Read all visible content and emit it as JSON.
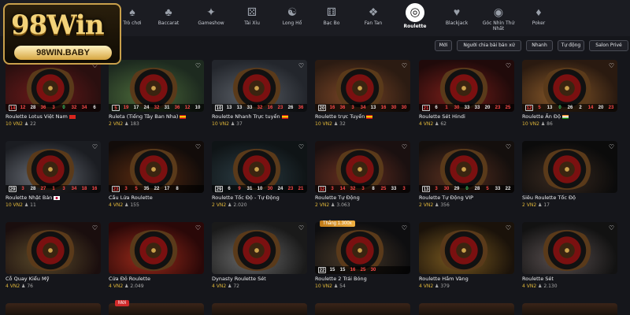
{
  "logo": {
    "big": "98Win",
    "sub": "98WIN.BABY"
  },
  "nav": [
    {
      "label": "Trò chơi",
      "icon": "game-icon"
    },
    {
      "label": "Baccarat",
      "icon": "baccarat-icon"
    },
    {
      "label": "Gameshow",
      "icon": "gameshow-icon"
    },
    {
      "label": "Tài Xỉu",
      "icon": "dice-icon"
    },
    {
      "label": "Long Hổ",
      "icon": "dragon-tiger-icon"
    },
    {
      "label": "Bạc Bo",
      "icon": "sicbo-icon"
    },
    {
      "label": "Fan Tan",
      "icon": "fantan-icon"
    },
    {
      "label": "Roulette",
      "icon": "roulette-icon"
    },
    {
      "label": "Blackjack",
      "icon": "blackjack-icon"
    },
    {
      "label": "Góc Nhìn Thứ Nhất",
      "icon": "first-person-icon"
    },
    {
      "label": "Poker",
      "icon": "poker-icon"
    }
  ],
  "filters": [
    "Mới",
    "Người chia bài bản xứ",
    "Nhanh",
    "Tự động",
    "Salon Privé"
  ],
  "cards": [
    {
      "title": "Roulette Lotus Việt Nam",
      "bet": "10 VN2",
      "players": "22",
      "flag": "vn",
      "nums": [
        {
          "v": "14",
          "c": "red",
          "box": true
        },
        {
          "v": "12",
          "c": "red"
        },
        {
          "v": "28",
          "c": "blk"
        },
        {
          "v": "36",
          "c": "red"
        },
        {
          "v": "3",
          "c": "red"
        },
        {
          "v": "0",
          "c": "grn"
        },
        {
          "v": "32",
          "c": "red"
        },
        {
          "v": "34",
          "c": "red"
        },
        {
          "v": "6",
          "c": "blk"
        }
      ]
    },
    {
      "title": "Ruleta (Tiếng Tây Ban Nha)",
      "bet": "2 VN2",
      "players": "183",
      "flag": "es",
      "nums": [
        {
          "v": "5",
          "c": "red",
          "box": true
        },
        {
          "v": "19",
          "c": "red"
        },
        {
          "v": "17",
          "c": "blk"
        },
        {
          "v": "24",
          "c": "blk"
        },
        {
          "v": "32",
          "c": "red"
        },
        {
          "v": "31",
          "c": "blk"
        },
        {
          "v": "36",
          "c": "red"
        },
        {
          "v": "12",
          "c": "red"
        },
        {
          "v": "10",
          "c": "blk"
        }
      ]
    },
    {
      "title": "Roulette Nhanh Trực tuyến",
      "bet": "10 VN2",
      "players": "37",
      "flag": "es",
      "nums": [
        {
          "v": "10",
          "c": "blk",
          "box": true
        },
        {
          "v": "13",
          "c": "blk"
        },
        {
          "v": "13",
          "c": "blk"
        },
        {
          "v": "33",
          "c": "blk"
        },
        {
          "v": "32",
          "c": "red"
        },
        {
          "v": "16",
          "c": "red"
        },
        {
          "v": "23",
          "c": "red"
        },
        {
          "v": "26",
          "c": "blk"
        },
        {
          "v": "36",
          "c": "red"
        }
      ]
    },
    {
      "title": "Roulette trực Tuyến",
      "bet": "10 VN2",
      "players": "32",
      "flag": "es",
      "nums": [
        {
          "v": "20",
          "c": "blk",
          "box": true
        },
        {
          "v": "16",
          "c": "red"
        },
        {
          "v": "36",
          "c": "red"
        },
        {
          "v": "3",
          "c": "red"
        },
        {
          "v": "34",
          "c": "red"
        },
        {
          "v": "13",
          "c": "blk"
        },
        {
          "v": "16",
          "c": "red"
        },
        {
          "v": "30",
          "c": "red"
        },
        {
          "v": "30",
          "c": "red"
        }
      ]
    },
    {
      "title": "Roulette Sét Hindi",
      "bet": "4 VN2",
      "players": "62",
      "flag": "",
      "nums": [
        {
          "v": "21",
          "c": "red",
          "box": true
        },
        {
          "v": "6",
          "c": "blk"
        },
        {
          "v": "1",
          "c": "red"
        },
        {
          "v": "30",
          "c": "red"
        },
        {
          "v": "33",
          "c": "blk"
        },
        {
          "v": "33",
          "c": "blk"
        },
        {
          "v": "20",
          "c": "blk"
        },
        {
          "v": "23",
          "c": "red"
        },
        {
          "v": "25",
          "c": "red"
        }
      ]
    },
    {
      "title": "Roulette Ấn Độ",
      "bet": "10 VN2",
      "players": "86",
      "flag": "in",
      "nums": [
        {
          "v": "12",
          "c": "red",
          "box": true
        },
        {
          "v": "5",
          "c": "red"
        },
        {
          "v": "13",
          "c": "blk"
        },
        {
          "v": "0",
          "c": "grn"
        },
        {
          "v": "26",
          "c": "blk"
        },
        {
          "v": "2",
          "c": "blk"
        },
        {
          "v": "14",
          "c": "red"
        },
        {
          "v": "20",
          "c": "blk"
        },
        {
          "v": "23",
          "c": "red"
        }
      ]
    },
    {
      "title": "Roulette Nhật Bản",
      "bet": "10 VN2",
      "players": "11",
      "flag": "jp",
      "nums": [
        {
          "v": "29",
          "c": "blk",
          "box": true
        },
        {
          "v": "3",
          "c": "red"
        },
        {
          "v": "28",
          "c": "blk"
        },
        {
          "v": "27",
          "c": "red"
        },
        {
          "v": "1",
          "c": "red"
        },
        {
          "v": "3",
          "c": "red"
        },
        {
          "v": "34",
          "c": "red"
        },
        {
          "v": "18",
          "c": "red"
        },
        {
          "v": "16",
          "c": "red"
        }
      ]
    },
    {
      "title": "Cầu Lửa Roulette",
      "bet": "4 VN2",
      "players": "155",
      "flag": "",
      "nums": [
        {
          "v": "23",
          "c": "red",
          "box": true
        },
        {
          "v": "3",
          "c": "red"
        },
        {
          "v": "5",
          "c": "red"
        },
        {
          "v": "35",
          "c": "blk"
        },
        {
          "v": "22",
          "c": "blk"
        },
        {
          "v": "17",
          "c": "blk"
        },
        {
          "v": "8",
          "c": "blk"
        },
        {
          "v": "",
          "c": "blk"
        },
        {
          "v": "",
          "c": "blk"
        }
      ]
    },
    {
      "title": "Roulette Tốc Độ - Tự Động",
      "bet": "2 VN2",
      "players": "2.020",
      "flag": "",
      "nums": [
        {
          "v": "29",
          "c": "blk",
          "box": true
        },
        {
          "v": "6",
          "c": "blk"
        },
        {
          "v": "9",
          "c": "red"
        },
        {
          "v": "31",
          "c": "blk"
        },
        {
          "v": "10",
          "c": "blk"
        },
        {
          "v": "30",
          "c": "red"
        },
        {
          "v": "24",
          "c": "blk"
        },
        {
          "v": "23",
          "c": "red"
        },
        {
          "v": "21",
          "c": "red"
        }
      ]
    },
    {
      "title": "Roulette Tự Động",
      "bet": "2 VN2",
      "players": "3.063",
      "flag": "",
      "nums": [
        {
          "v": "32",
          "c": "red",
          "box": true
        },
        {
          "v": "3",
          "c": "red"
        },
        {
          "v": "14",
          "c": "red"
        },
        {
          "v": "32",
          "c": "red"
        },
        {
          "v": "3",
          "c": "red"
        },
        {
          "v": "8",
          "c": "blk"
        },
        {
          "v": "25",
          "c": "red"
        },
        {
          "v": "33",
          "c": "blk"
        },
        {
          "v": "3",
          "c": "red"
        }
      ]
    },
    {
      "title": "Roulette Tự Động VIP",
      "bet": "2 VN2",
      "players": "356",
      "flag": "",
      "nums": [
        {
          "v": "13",
          "c": "blk",
          "box": true
        },
        {
          "v": "3",
          "c": "red"
        },
        {
          "v": "30",
          "c": "red"
        },
        {
          "v": "29",
          "c": "blk"
        },
        {
          "v": "0",
          "c": "grn"
        },
        {
          "v": "28",
          "c": "blk"
        },
        {
          "v": "5",
          "c": "red"
        },
        {
          "v": "33",
          "c": "blk"
        },
        {
          "v": "22",
          "c": "blk"
        }
      ]
    },
    {
      "title": "Siêu Roulette Tốc Độ",
      "bet": "2 VN2",
      "players": "17",
      "flag": "",
      "nums": []
    },
    {
      "title": "Cỗ Quay Kiểu Mỹ",
      "bet": "4 VN2",
      "players": "76",
      "flag": "",
      "nums": []
    },
    {
      "title": "Cửa Đỏ Roulette",
      "bet": "4 VN2",
      "players": "2.049",
      "flag": "",
      "nums": []
    },
    {
      "title": "Dynasty Roulette Sét",
      "bet": "4 VN2",
      "players": "72",
      "flag": "",
      "nums": []
    },
    {
      "title": "Roulette 2 Trái Bóng",
      "bet": "10 VN2",
      "players": "54",
      "flag": "",
      "badge": "Thắng 1.300x",
      "nums": [
        {
          "v": "22",
          "c": "blk",
          "box": true
        },
        {
          "v": "15",
          "c": "blk"
        },
        {
          "v": "15",
          "c": "blk"
        },
        {
          "v": "16",
          "c": "red"
        },
        {
          "v": "25",
          "c": "red"
        },
        {
          "v": "30",
          "c": "red"
        }
      ]
    },
    {
      "title": "Roulette Hầm Vàng",
      "bet": "4 VN2",
      "players": "379",
      "flag": "",
      "nums": []
    },
    {
      "title": "Roulette Sét",
      "bet": "4 VN2",
      "players": "2.130",
      "flag": "",
      "nums": []
    }
  ],
  "row4_new_badge": "Mới",
  "colors": {
    "gold": "#e3b93a",
    "bg": "#15161b",
    "red": "#ff4a4a"
  }
}
